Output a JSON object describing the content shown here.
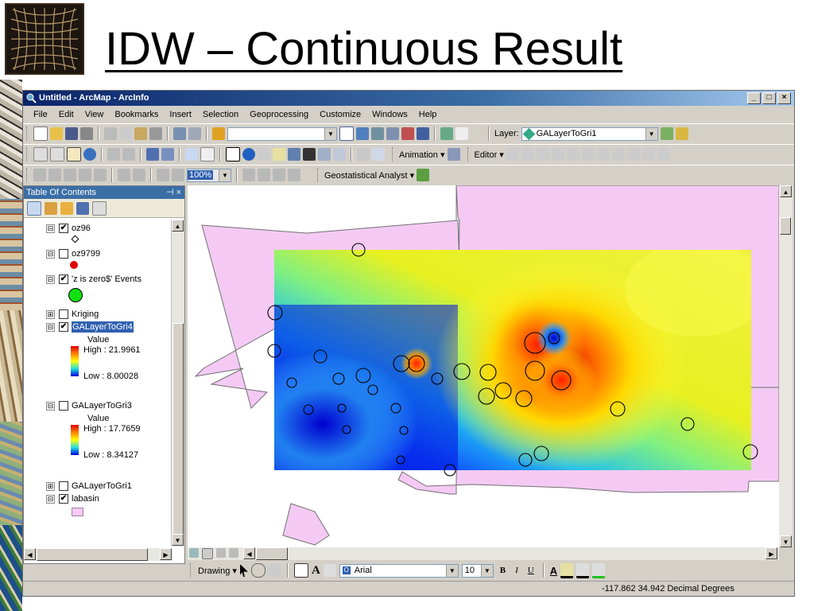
{
  "slide": {
    "title": "IDW – Continuous Result"
  },
  "window": {
    "title": "Untitled - ArcMap - ArcInfo",
    "controls": [
      "_",
      "□",
      "×"
    ]
  },
  "menu": [
    "File",
    "Edit",
    "View",
    "Bookmarks",
    "Insert",
    "Selection",
    "Geoprocessing",
    "Customize",
    "Windows",
    "Help"
  ],
  "toolbars": {
    "layer_label": "Layer:",
    "layer_value": "GALayerToGri1",
    "animation_label": "Animation ▾",
    "editor_label": "Editor ▾",
    "zoom_value": "100%",
    "geostat_label": "Geostatistical Analyst ▾"
  },
  "toc": {
    "title": "Table Of Contents",
    "pin": "⊣ ×",
    "layers": [
      {
        "name": "oz96",
        "checked": "✔",
        "expand": "⊟"
      },
      {
        "name": "oz9799",
        "checked": "",
        "expand": "⊟"
      },
      {
        "name": "'z is zero$' Events",
        "checked": "✔",
        "expand": "⊟"
      },
      {
        "name": "Kriging",
        "checked": "",
        "expand": "⊞"
      },
      {
        "name": "GALayerToGri4",
        "checked": "✔",
        "expand": "⊟"
      },
      {
        "name": "GALayerToGri3",
        "checked": "",
        "expand": "⊟"
      },
      {
        "name": "GALayerToGri1",
        "checked": "",
        "expand": "⊞"
      },
      {
        "name": "labasin",
        "checked": "✔",
        "expand": "⊟"
      }
    ],
    "gri4_legend": {
      "title": "Value",
      "high": "High : 21.9961",
      "low": "Low : 8.00028"
    },
    "gri3_legend": {
      "title": "Value",
      "high": "High : 17.7659",
      "low": "Low : 8.34127"
    }
  },
  "draw_toolbar": {
    "drawing_label": "Drawing ▾",
    "font_name": "Arial",
    "font_size": "10",
    "bold": "B",
    "italic": "I",
    "underline": "U",
    "font_color": "A"
  },
  "status": {
    "coords": "-117.862  34.942 Decimal Degrees"
  },
  "colors": {
    "basin_fill": "#f4caf4",
    "high": "#e00000",
    "low": "#1020d0"
  },
  "icons": [
    "new-icon",
    "open-icon",
    "save-icon",
    "print-icon",
    "cut-icon",
    "copy-icon",
    "paste-icon",
    "delete-icon",
    "undo-icon",
    "redo-icon",
    "add-data-icon",
    "zoom-in-icon",
    "zoom-out-icon",
    "pan-icon",
    "globe-icon",
    "select-icon",
    "identify-icon",
    "find-icon",
    "binoculars-icon"
  ]
}
